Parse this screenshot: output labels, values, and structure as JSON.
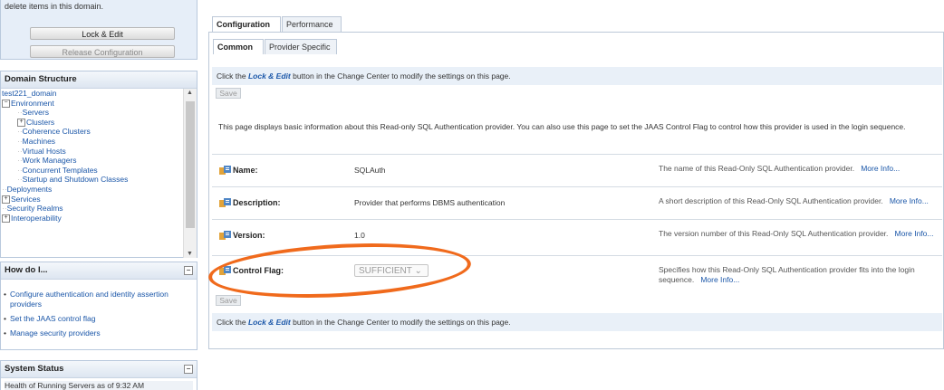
{
  "change_center": {
    "text": "delete items in this domain.",
    "lock_label": "Lock & Edit",
    "release_label": "Release Configuration"
  },
  "domain_structure": {
    "title": "Domain Structure",
    "items": [
      {
        "label": "test221_domain",
        "level": 0,
        "expander": ""
      },
      {
        "label": "Environment",
        "level": 0,
        "expander": "−"
      },
      {
        "label": "Servers",
        "level": 1,
        "expander": ""
      },
      {
        "label": "Clusters",
        "level": 1,
        "expander": "+"
      },
      {
        "label": "Coherence Clusters",
        "level": 1,
        "expander": ""
      },
      {
        "label": "Machines",
        "level": 1,
        "expander": ""
      },
      {
        "label": "Virtual Hosts",
        "level": 1,
        "expander": ""
      },
      {
        "label": "Work Managers",
        "level": 1,
        "expander": ""
      },
      {
        "label": "Concurrent Templates",
        "level": 1,
        "expander": ""
      },
      {
        "label": "Startup and Shutdown Classes",
        "level": 1,
        "expander": ""
      },
      {
        "label": "Deployments",
        "level": 0,
        "expander": ""
      },
      {
        "label": "Services",
        "level": 0,
        "expander": "+"
      },
      {
        "label": "Security Realms",
        "level": 0,
        "expander": ""
      },
      {
        "label": "Interoperability",
        "level": 0,
        "expander": "+"
      }
    ]
  },
  "how_do_i": {
    "title": "How do I...",
    "items": [
      "Configure authentication and identity assertion providers",
      "Set the JAAS control flag",
      "Manage security providers"
    ]
  },
  "system_status": {
    "title": "System Status",
    "text": "Health of Running Servers as of  9:32 AM"
  },
  "tabs": {
    "primary": [
      {
        "label": "Configuration",
        "active": true
      },
      {
        "label": "Performance",
        "active": false
      }
    ],
    "secondary": [
      {
        "label": "Common",
        "active": true
      },
      {
        "label": "Provider Specific",
        "active": false
      }
    ]
  },
  "hint": {
    "before": "Click the ",
    "strong": "Lock & Edit",
    "after": " button in the Change Center to modify the settings on this page."
  },
  "save_label": "Save",
  "intro": "This page displays basic information about this Read-only SQL Authentication provider. You can also use this page to set the JAAS Control Flag to control how this provider is used in the login sequence.",
  "fields": {
    "name": {
      "label": "Name:",
      "value": "SQLAuth",
      "desc": "The name of this Read-Only SQL Authentication provider.",
      "more": "More Info..."
    },
    "description": {
      "label": "Description:",
      "value": "Provider that performs DBMS authentication",
      "desc": "A short description of this Read-Only SQL Authentication provider.",
      "more": "More Info..."
    },
    "version": {
      "label": "Version:",
      "value": "1.0",
      "desc": "The version number of this Read-Only SQL Authentication provider.",
      "more": "More Info..."
    },
    "control_flag": {
      "label": "Control Flag:",
      "value": "SUFFICIENT",
      "desc": "Specifies how this Read-Only SQL Authentication provider fits into the login sequence.",
      "more": "More Info..."
    }
  },
  "colors": {
    "annotation": "#f06a1c",
    "link": "#1a56a8"
  }
}
